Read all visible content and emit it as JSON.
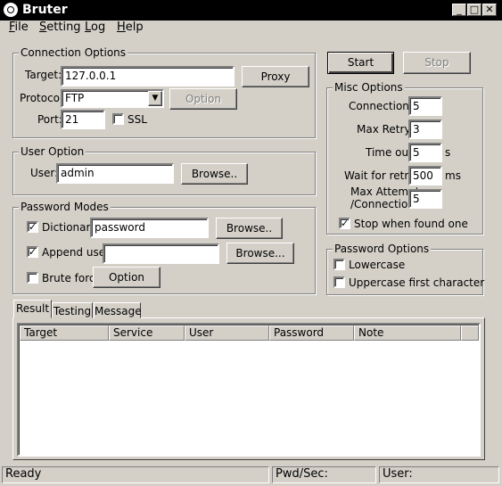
{
  "window": {
    "title": "Bruter"
  },
  "menu": [
    "File",
    "Setting",
    "Log",
    "Help"
  ],
  "connection": {
    "title": "Connection Options",
    "target_label": "Target:",
    "target_value": "127.0.0.1",
    "proxy_label": "Proxy",
    "protocol_label": "Protocol:",
    "protocol_value": "FTP",
    "option_label": "Option",
    "port_label": "Port:",
    "port_value": "21",
    "ssl_label": "SSL"
  },
  "user_option": {
    "title": "User Option",
    "user_label": "User:",
    "user_value": "admin",
    "browse_label": "Browse.."
  },
  "password_modes": {
    "title": "Password Modes",
    "dictionary_label": "Dictionary:",
    "dictionary_value": "password",
    "dictionary_browse": "Browse..",
    "append_label": "Append user:",
    "append_value": "",
    "append_browse": "Browse...",
    "brute_label": "Brute force",
    "brute_option": "Option"
  },
  "actions": {
    "start": "Start",
    "stop": "Stop"
  },
  "misc": {
    "title": "Misc Options",
    "connections_label": "Connections:",
    "connections_value": "5",
    "retry_label": "Max Retry:",
    "retry_value": "3",
    "timeout_label": "Time out:",
    "timeout_value": "5",
    "timeout_unit": "s",
    "wait_label": "Wait for retry:",
    "wait_value": "500",
    "wait_unit": "ms",
    "max_attempt_label_1": "Max Attempt",
    "max_attempt_label_2": "/Connection:",
    "max_attempt_value": "5",
    "stop_label": "Stop when found one"
  },
  "pw_options": {
    "title": "Password Options",
    "lowercase_label": "Lowercase",
    "uppercase_label": "Uppercase first character"
  },
  "tabs": [
    "Result",
    "Testing",
    "Message"
  ],
  "columns": [
    "Target",
    "Service",
    "User",
    "Password",
    "Note"
  ],
  "statusbar": {
    "ready": "Ready",
    "pwd_sec": "Pwd/Sec:",
    "user": "User:"
  }
}
